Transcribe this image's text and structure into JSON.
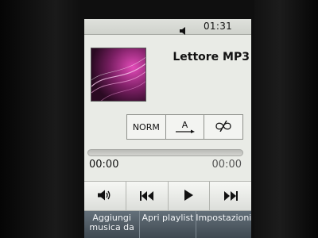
{
  "status_bar": {
    "icon": "speaker-icon",
    "time": "01:31"
  },
  "player": {
    "title": "Lettore MP3",
    "album_art": "album-art-image"
  },
  "modes": {
    "equalizer_label": "NORM",
    "repeat_label": "A",
    "repeat_icon": "repeat-one-icon",
    "shuffle_icon": "shuffle-off-icon"
  },
  "progress": {
    "fraction": 0,
    "elapsed": "00:00",
    "total": "00:00"
  },
  "controls": [
    {
      "name": "volume-button",
      "icon": "volume-icon"
    },
    {
      "name": "previous-button",
      "icon": "previous-icon"
    },
    {
      "name": "play-button",
      "icon": "play-icon"
    },
    {
      "name": "next-button",
      "icon": "next-icon"
    }
  ],
  "softkeys": {
    "add_music": "Aggiungi musica da",
    "open_playlist": "Apri playlist",
    "settings": "Impostazioni"
  },
  "colors": {
    "screen_bg": "#e9ebe6",
    "softkey_bar": "#4f5a63",
    "album_art_accent": "#c2309a"
  }
}
